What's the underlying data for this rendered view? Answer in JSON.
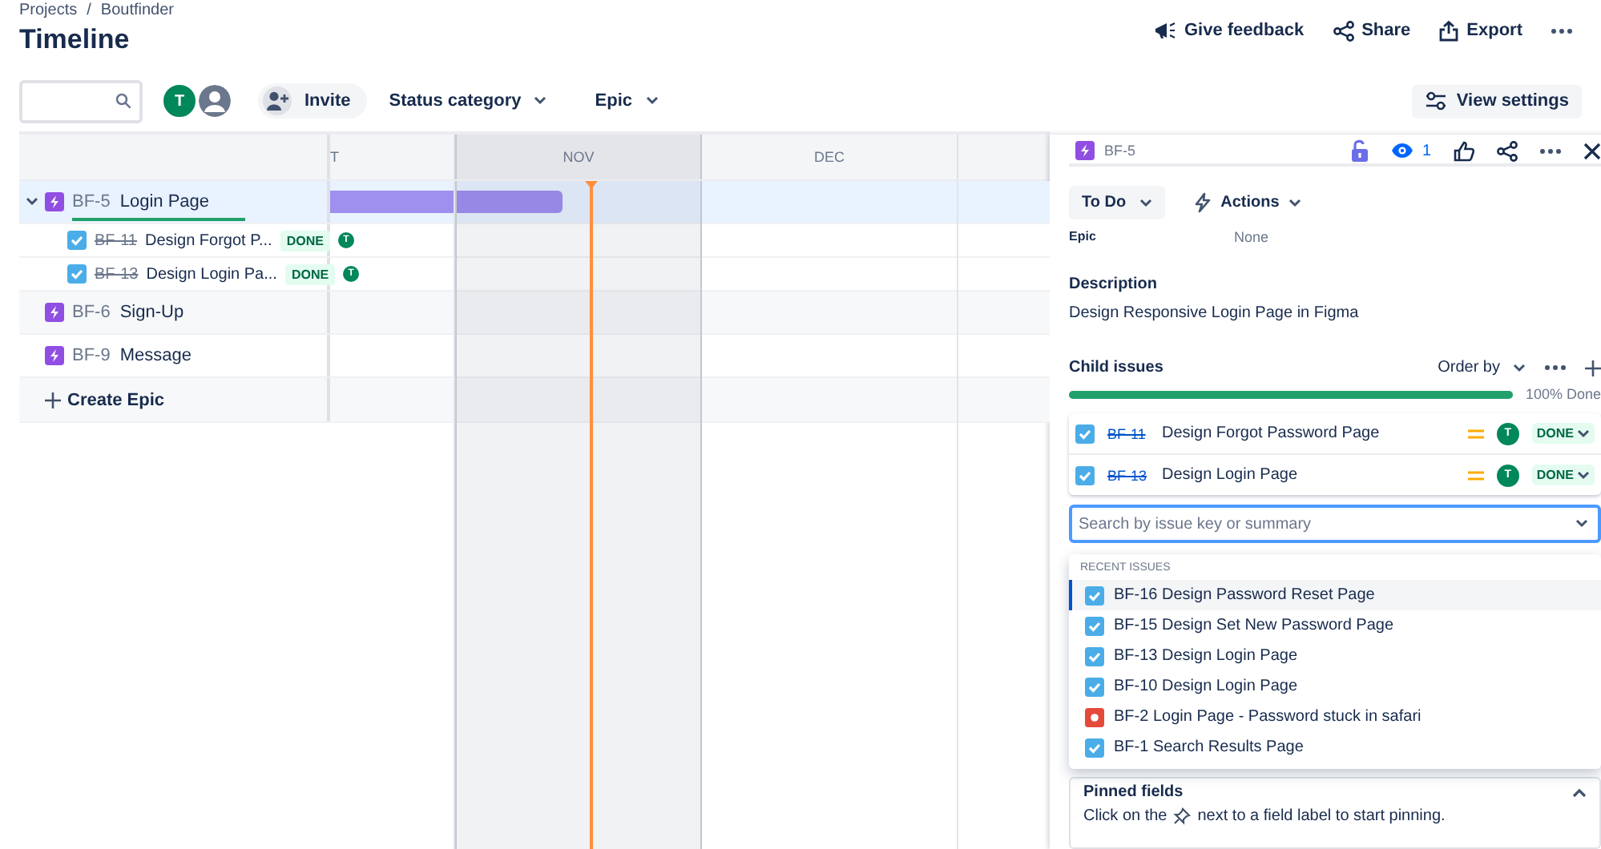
{
  "breadcrumbs": [
    {
      "label": "Projects"
    },
    {
      "label": "Boutfinder"
    }
  ],
  "breadcrumb_separator": "/",
  "title": "Timeline",
  "header_actions": [
    {
      "kind": "feedback",
      "label": "Give feedback"
    },
    {
      "kind": "share",
      "label": "Share"
    },
    {
      "kind": "export",
      "label": "Export"
    },
    {
      "kind": "more"
    }
  ],
  "toolbar": {
    "avatars": [
      {
        "kind": "initial",
        "initial": "T",
        "color": "#00875a"
      },
      {
        "kind": "silhouette"
      }
    ],
    "invite": "Invite",
    "filters": [
      {
        "label": "Status category"
      },
      {
        "label": "Epic"
      }
    ],
    "view_settings": "View settings"
  },
  "timeline": {
    "months": [
      {
        "label": "T",
        "highlighted": false
      },
      {
        "label": "NOV",
        "highlighted": true
      },
      {
        "label": "DEC",
        "highlighted": false
      },
      {
        "highlighted": false
      }
    ],
    "epics": [
      {
        "key": "BF-5",
        "summary": "Login Page",
        "selected": true,
        "expanded": true,
        "level": 1,
        "scheduled": true,
        "children": [
          {
            "key": "BF-11",
            "summary": "Design Forgot P...",
            "done": true,
            "status": "DONE",
            "assignee": "T"
          },
          {
            "key": "BF-13",
            "summary": "Design Login Pa...",
            "done": true,
            "status": "DONE",
            "assignee": "T"
          }
        ]
      },
      {
        "key": "BF-6",
        "summary": "Sign-Up",
        "selected": false,
        "expanded": false,
        "scheduled": false
      },
      {
        "key": "BF-9",
        "summary": "Message",
        "selected": false,
        "expanded": false,
        "scheduled": false
      }
    ],
    "create_label": "Create Epic"
  },
  "detail": {
    "key": "BF-5",
    "watchers": "1",
    "status": "To Do",
    "actions": "Actions",
    "fields": [
      {
        "label": "Epic",
        "value": "None"
      }
    ],
    "description_label": "Description",
    "description": "Design Responsive Login Page in Figma",
    "child_issues": {
      "title": "Child issues",
      "order_by": "Order by",
      "level": 1,
      "progress_text": "100% Done",
      "items": [
        {
          "key": "BF-11",
          "summary": "Design Forgot Password Page",
          "done": true,
          "assignee": "T",
          "status": "DONE"
        },
        {
          "key": "BF-13",
          "summary": "Design Login Page",
          "done": true,
          "assignee": "T",
          "status": "DONE"
        }
      ]
    },
    "search": {
      "placeholder": "Search by issue key or summary"
    },
    "recent": {
      "heading": "RECENT ISSUES",
      "items": [
        {
          "text": "BF-16 Design Password Reset Page",
          "kind": "task",
          "selected": true
        },
        {
          "text": "BF-15 Design Set New Password Page",
          "kind": "task",
          "selected": false
        },
        {
          "text": "BF-13 Design Login Page",
          "kind": "task",
          "selected": false
        },
        {
          "text": "BF-10 Design Login Page",
          "kind": "task",
          "selected": false
        },
        {
          "text": "BF-2 Login Page - Password stuck in safari",
          "kind": "bug",
          "selected": false
        },
        {
          "text": "BF-1 Search Results Page",
          "kind": "task",
          "selected": false
        }
      ]
    },
    "pinned": {
      "title": "Pinned fields",
      "hint_before": "Click on the",
      "hint_after": "next to a field label to start pinning."
    }
  }
}
